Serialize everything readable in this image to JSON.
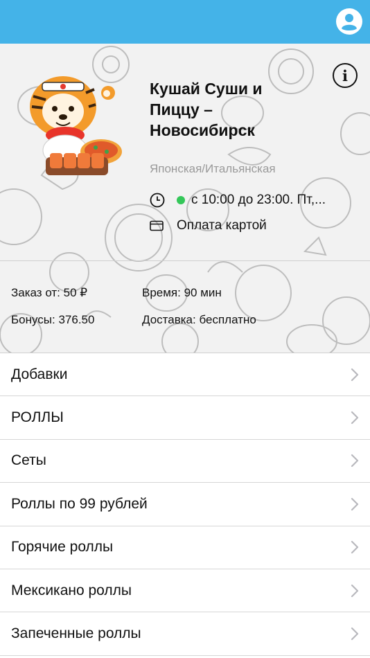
{
  "restaurant": {
    "name": "Кушай Суши и Пиццу – Новосибирск",
    "cuisine": "Японская/Итальянская",
    "hours": "с 10:00 до 23:00. Пт,...",
    "payment": "Оплата картой",
    "open_status_color": "#34c759"
  },
  "stats": {
    "min_order": "Заказ от: 50 ₽",
    "time": "Время: 90 мин",
    "bonuses": "Бонусы: 376.50",
    "delivery": "Доставка: бесплатно"
  },
  "icons": {
    "profile": "user-circle-icon",
    "info": "info-icon",
    "clock": "clock-icon",
    "card": "credit-card-icon",
    "chevron": "chevron-right-icon"
  },
  "colors": {
    "topbar": "#44b3e8"
  },
  "menu": [
    {
      "label": "Добавки"
    },
    {
      "label": "РОЛЛЫ"
    },
    {
      "label": "Сеты"
    },
    {
      "label": "Роллы по 99 рублей"
    },
    {
      "label": "Горячие роллы"
    },
    {
      "label": "Мексикано роллы"
    },
    {
      "label": "Запеченные роллы"
    }
  ]
}
